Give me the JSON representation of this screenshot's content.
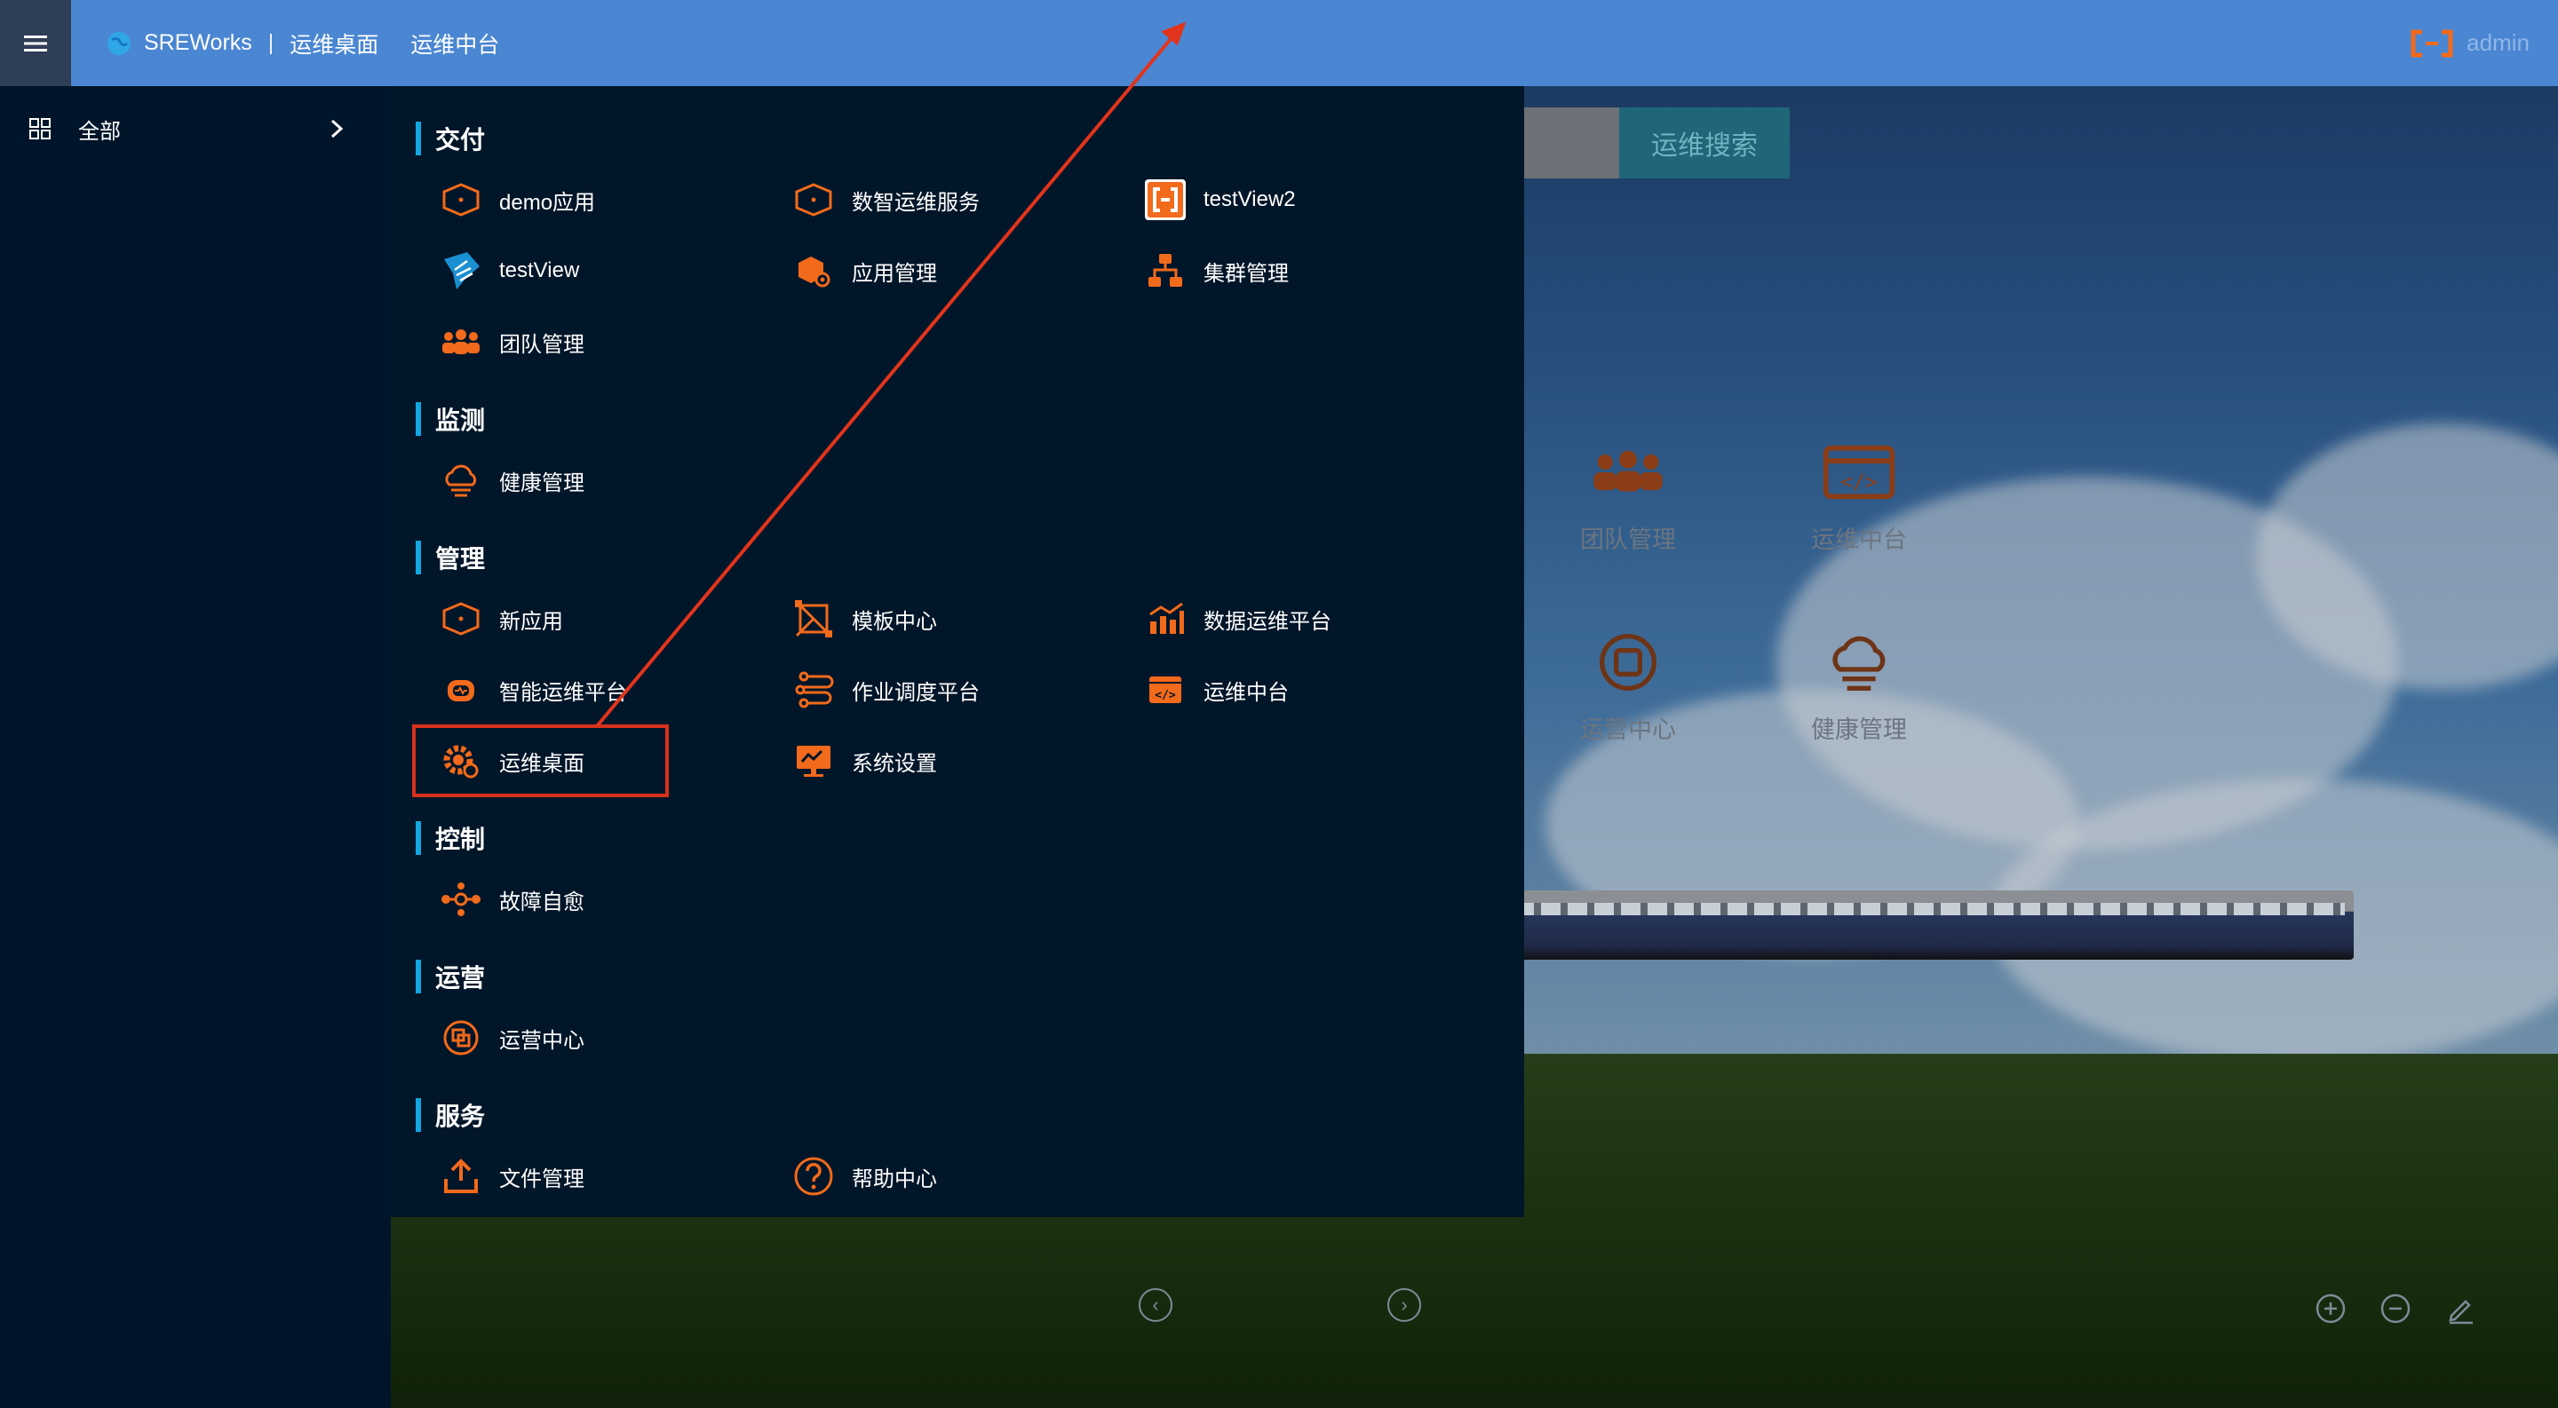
{
  "topbar": {
    "brand": "SREWorks",
    "separator": "|",
    "crumb_desk": "运维桌面",
    "crumb_platform": "运维中台",
    "user": "admin"
  },
  "sidebar": {
    "all_label": "全部"
  },
  "desktop": {
    "search_button": "运维搜索",
    "apps": [
      {
        "label": "团队管理",
        "icon": "team-icon"
      },
      {
        "label": "运维中台",
        "icon": "ops-platform-icon"
      },
      {
        "label": "运营中心",
        "icon": "operations-center-icon"
      },
      {
        "label": "健康管理",
        "icon": "health-icon"
      }
    ]
  },
  "panel": {
    "sections": [
      {
        "title": "交付"
      },
      {
        "title": "监测"
      },
      {
        "title": "管理"
      },
      {
        "title": "控制"
      },
      {
        "title": "运营"
      },
      {
        "title": "服务"
      }
    ],
    "items": {
      "demo_app": "demo应用",
      "data_ops_service": "数智运维服务",
      "testview2": "testView2",
      "testview": "testView",
      "app_mgmt": "应用管理",
      "cluster_mgmt": "集群管理",
      "team_mgmt": "团队管理",
      "health_mgmt": "健康管理",
      "new_app": "新应用",
      "template_center": "模板中心",
      "data_ops_platform": "数据运维平台",
      "aiops_platform": "智能运维平台",
      "job_platform": "作业调度平台",
      "ops_center": "运维中台",
      "ops_desktop": "运维桌面",
      "system_settings": "系统设置",
      "self_healing": "故障自愈",
      "operations_center": "运营中心",
      "file_mgmt": "文件管理",
      "help_center": "帮助中心"
    }
  },
  "colors": {
    "topbar": "#4a86d2",
    "panel": "#021629",
    "accent_orange": "#f26a1b",
    "section_bar": "#12a7e0",
    "highlight": "#d8311c"
  }
}
